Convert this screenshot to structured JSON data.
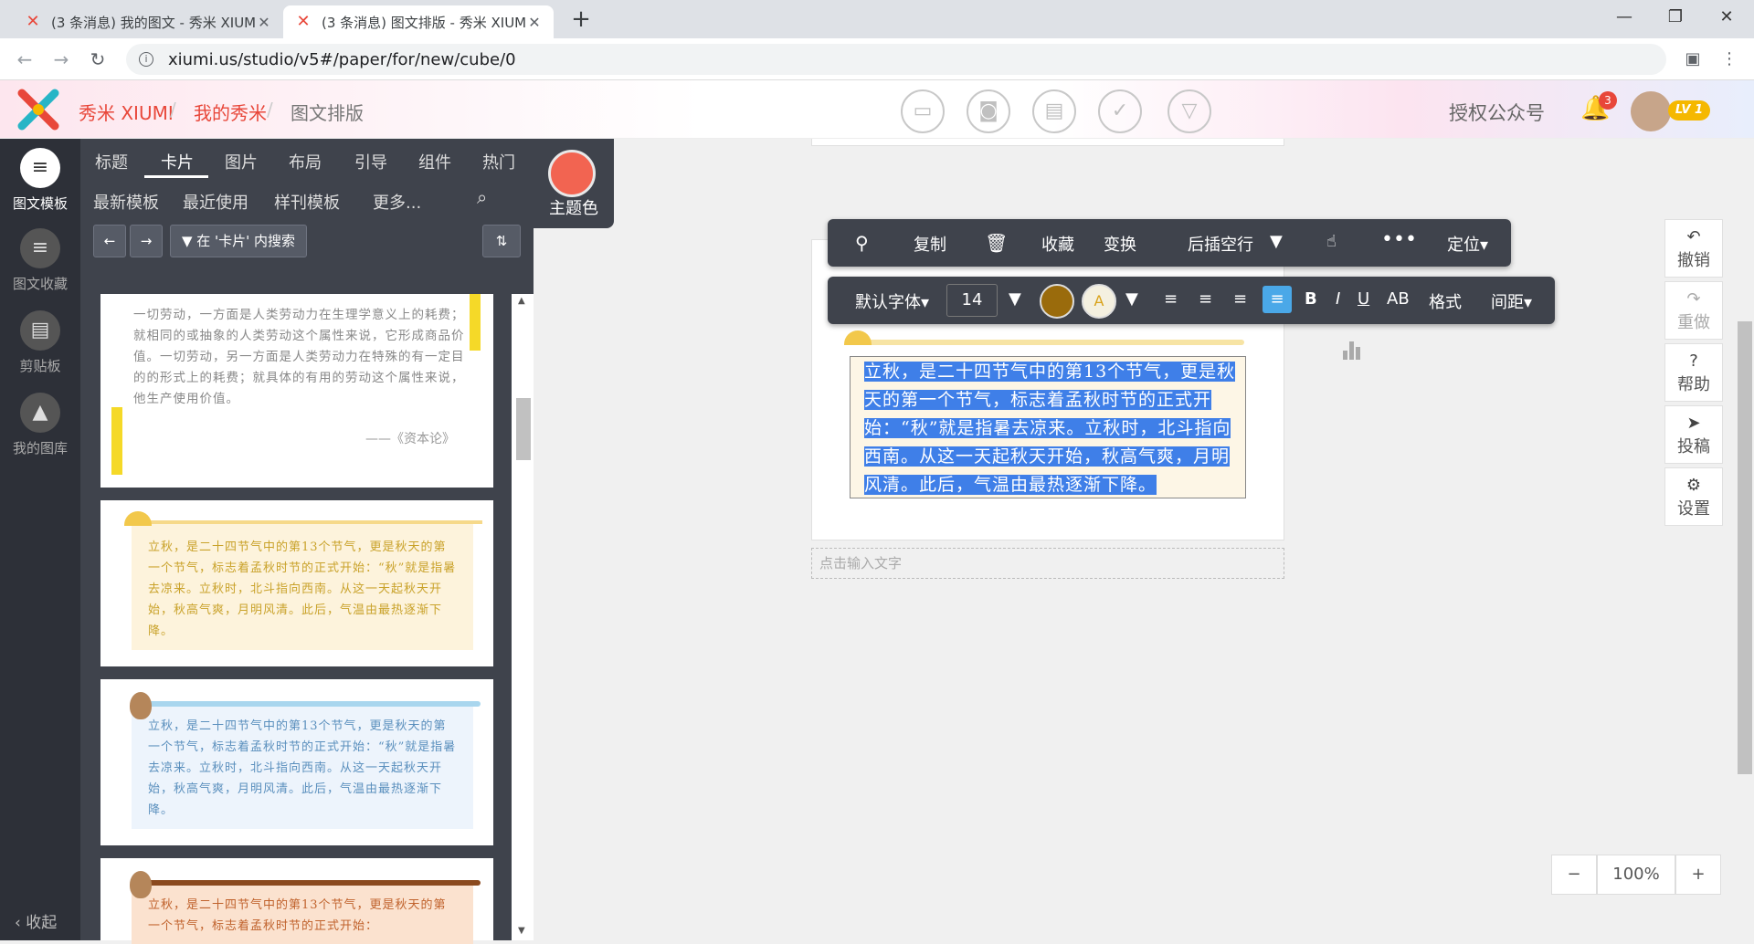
{
  "browser": {
    "tabs": [
      {
        "title": "(3 条消息) 我的图文 - 秀米 XIUMI"
      },
      {
        "title": "(3 条消息) 图文排版 - 秀米 XIUMI"
      }
    ],
    "new_tab": "+",
    "url": "xiumi.us/studio/v5#/paper/for/new/cube/0"
  },
  "app": {
    "brand": "秀米 XIUMI",
    "breadcrumb": [
      "我的秀米",
      "图文排版"
    ],
    "authorize": "授权公众号",
    "notif_count": "3",
    "level": "LV 1"
  },
  "leftnav": [
    {
      "label": "图文模板"
    },
    {
      "label": "图文收藏"
    },
    {
      "label": "剪贴板"
    },
    {
      "label": "我的图库"
    }
  ],
  "collapse": "收起",
  "categories": [
    "标题",
    "卡片",
    "图片",
    "布局",
    "引导",
    "组件",
    "热门"
  ],
  "subcategories": [
    "最新模板",
    "最近使用",
    "样刊模板",
    "更多..."
  ],
  "theme_label": "主题色",
  "search_in": "在 '卡片' 内搜索",
  "cards": {
    "quote": "一切劳动，一方面是人类劳动力在生理学意义上的耗费；就相同的或抽象的人类劳动这个属性来说，它形成商品价值。一切劳动，另一方面是人类劳动力在特殊的有一定目的的形式上的耗费；就具体的有用的劳动这个属性来说，他生产使用价值。",
    "quote_source": "——《资本论》",
    "autumn": "立秋，是二十四节气中的第13个节气，更是秋天的第一个节气，标志着孟秋时节的正式开始：“秋”就是指暑去凉来。立秋时，北斗指向西南。从这一天起秋天开始，秋高气爽，月明风清。此后，气温由最热逐渐下降。",
    "autumn_short": "立秋，是二十四节气中的第13个节气，更是秋天的第一个节气，标志着孟秋时节的正式开始："
  },
  "toolbar1": [
    "复制",
    "收藏",
    "变换",
    "后插空行",
    "定位"
  ],
  "toolbar2": {
    "font": "默认字体",
    "size": "14",
    "bold": "B",
    "italic": "I",
    "underline": "U",
    "caps": "AB",
    "format": "格式",
    "spacing": "间距"
  },
  "editor": {
    "selected_text": "立秋，是二十四节气中的第13个节气，更是秋天的第一个节气，标志着孟秋时节的正式开始：“秋”就是指暑去凉来。立秋时，北斗指向西南。从这一天起秋天开始，秋高气爽，月明风清。此后，气温由最热逐渐下降。",
    "placeholder": "点击输入文字"
  },
  "right_actions": [
    "撤销",
    "重做",
    "帮助",
    "投稿",
    "设置"
  ],
  "zoom": "100%",
  "colors": {
    "accent": "#e8473a",
    "panel": "#3f434c",
    "theme": "#f26451",
    "font_color": "#9a6b0c",
    "selection": "#3f7fe8"
  }
}
